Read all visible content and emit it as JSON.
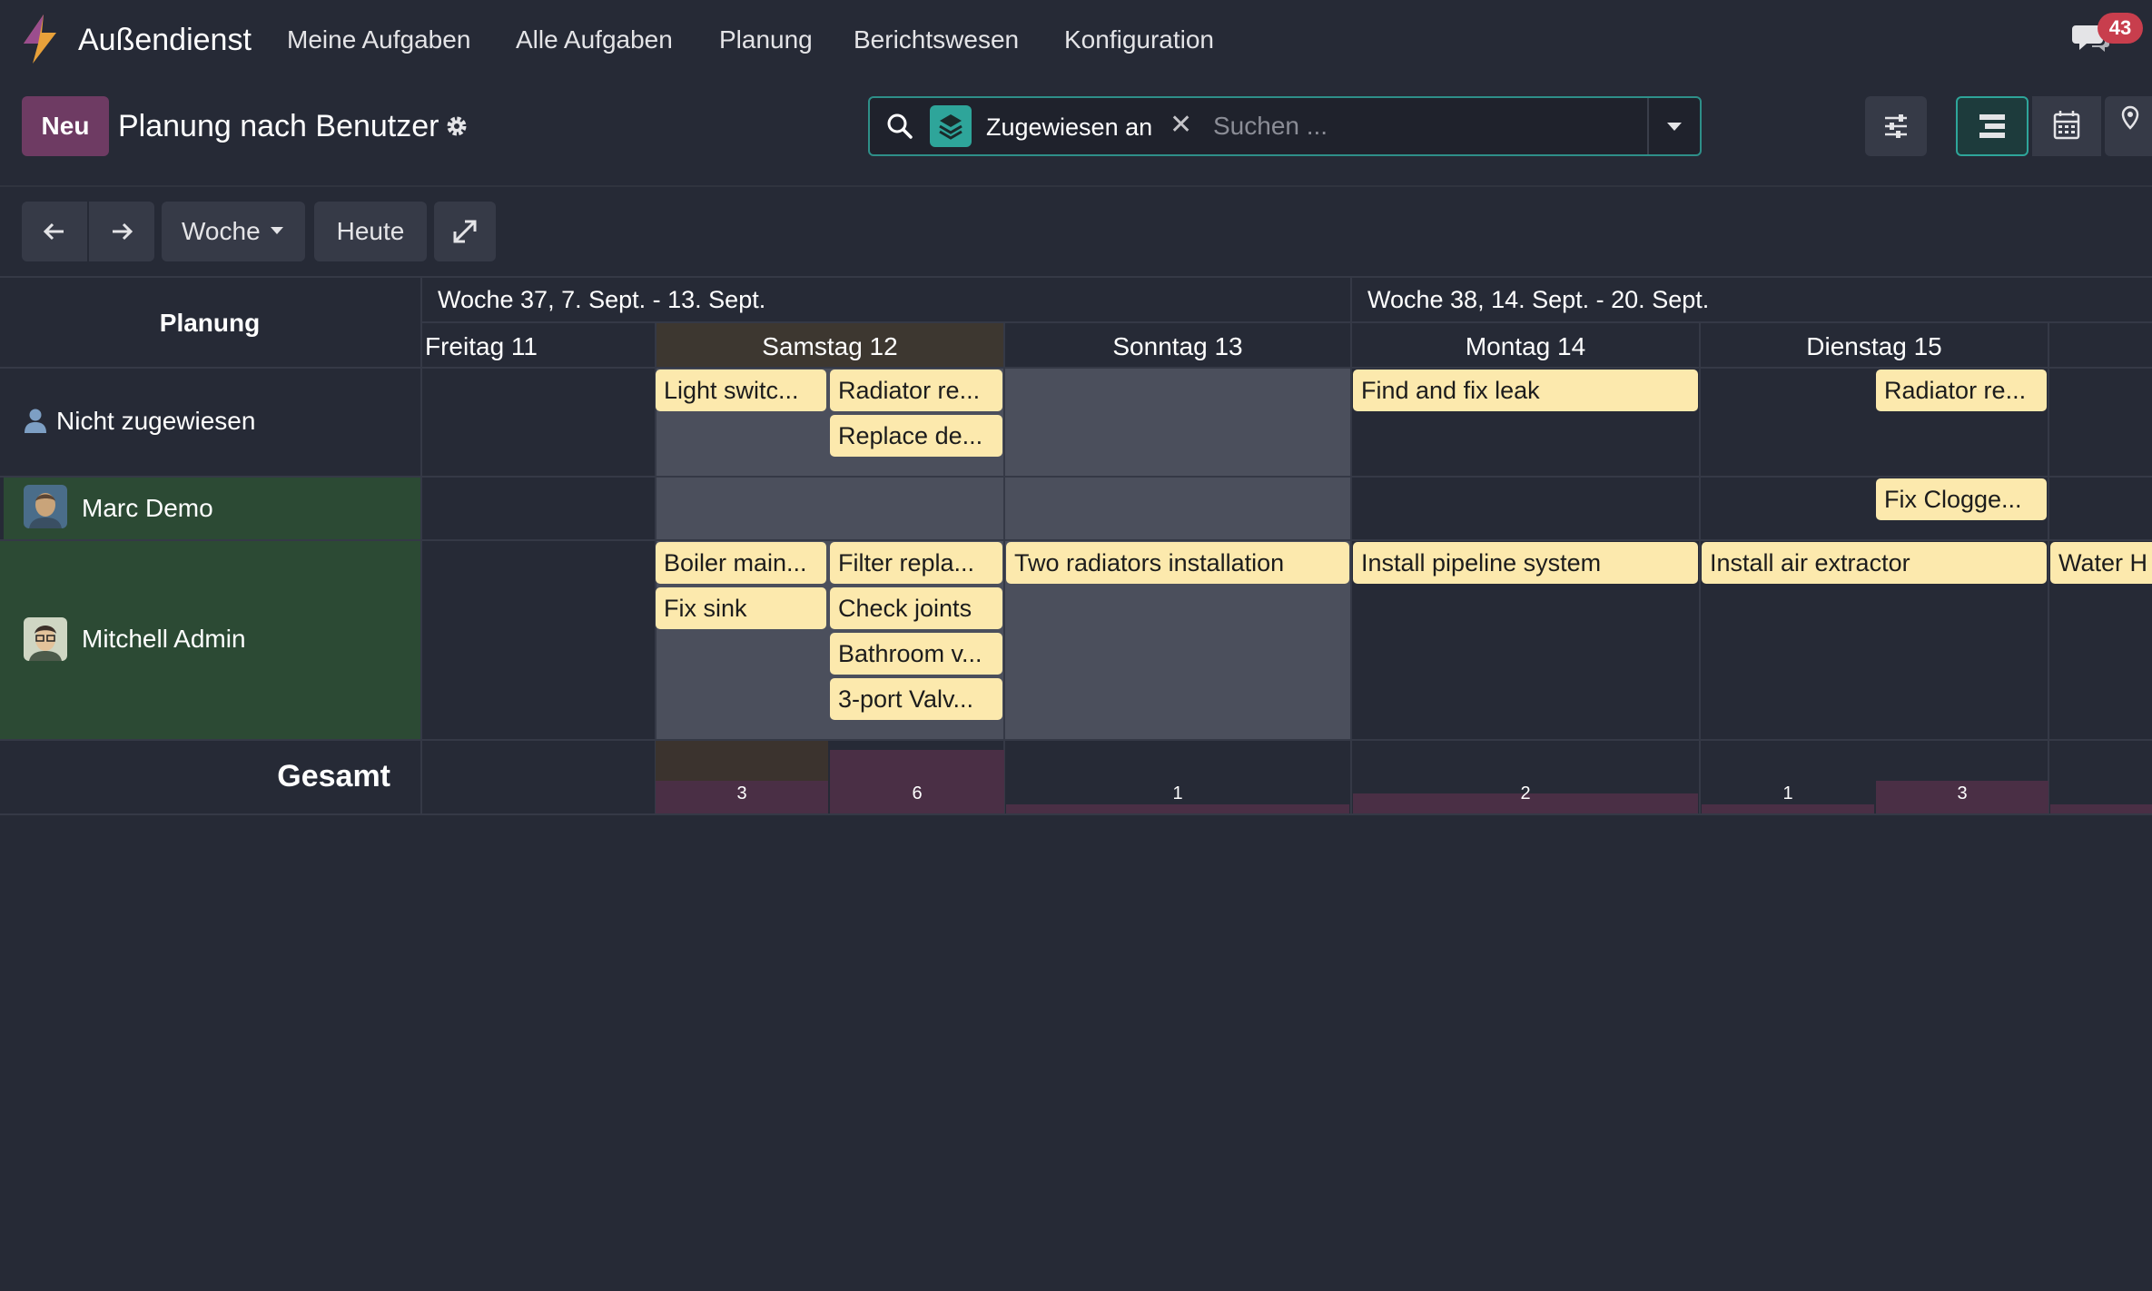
{
  "app": {
    "name": "Außendienst",
    "menu": [
      "Meine Aufgaben",
      "Alle Aufgaben",
      "Planung",
      "Berichtswesen",
      "Konfiguration"
    ],
    "chat_count": "43"
  },
  "control": {
    "new_label": "Neu",
    "title": "Planung nach Benutzer",
    "facet_label": "Zugewiesen an",
    "search_placeholder": "Suchen ..."
  },
  "toolbar": {
    "scale_label": "Woche",
    "today_label": "Heute"
  },
  "gantt": {
    "header_label": "Planung",
    "weeks": [
      "Woche 37, 7. Sept. - 13. Sept.",
      "Woche 38, 14. Sept. - 20. Sept."
    ],
    "days": [
      "Freitag 11",
      "Samstag 12",
      "Sonntag 13",
      "Montag 14",
      "Dienstag 15"
    ],
    "rows": [
      "Nicht zugewiesen",
      "Marc Demo",
      "Mitchell Admin"
    ],
    "total_label": "Gesamt",
    "tasks": {
      "t1": "Light switc...",
      "t2": "Radiator re...",
      "t3": "Replace de...",
      "t4": "Find and fix leak",
      "t5": "Radiator re...",
      "t6": "Fix Clogge...",
      "t7": "Boiler main...",
      "t8": "Filter repla...",
      "t9": "Two radiators installation",
      "t10": "Install pipeline system",
      "t11": "Install air extractor",
      "t12": "Water H",
      "t13": "Fix sink",
      "t14": "Check joints",
      "t15": "Bathroom v...",
      "t16": "3-port Valv..."
    },
    "totals": [
      "3",
      "6",
      "1",
      "2",
      "1",
      "3"
    ]
  },
  "colors": {
    "background": "#262a36",
    "accent": "#2ea59a",
    "brand": "#6e3b63",
    "pill": "#fce9ad",
    "row_highlight": "#2c4a34",
    "badge": "#c83e4d"
  }
}
